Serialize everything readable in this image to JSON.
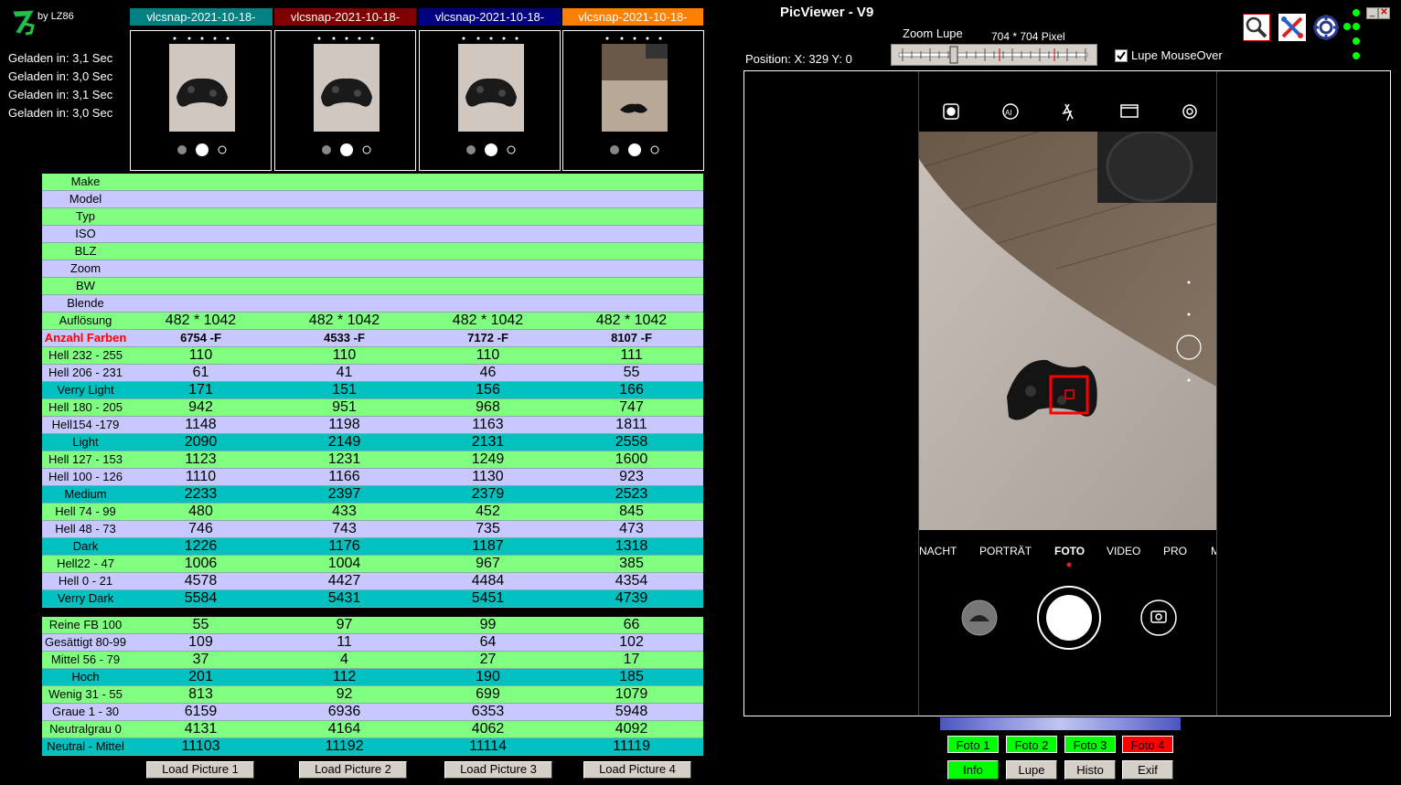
{
  "app": {
    "by": "by LZ86",
    "title": "PicViewer - V9"
  },
  "load_times": [
    "Geladen in: 3,1 Sec",
    "Geladen in: 3,0 Sec",
    "Geladen in: 3,1 Sec",
    "Geladen in: 3,0 Sec"
  ],
  "columns": [
    {
      "label": "vlcsnap-2021-10-18-",
      "color": "#008080"
    },
    {
      "label": "vlcsnap-2021-10-18-",
      "color": "#800000"
    },
    {
      "label": "vlcsnap-2021-10-18-",
      "color": "#000080"
    },
    {
      "label": "vlcsnap-2021-10-18-",
      "color": "#ff8000"
    }
  ],
  "rows": [
    {
      "label": "Make",
      "style": "g",
      "values": [
        "",
        "",
        "",
        ""
      ]
    },
    {
      "label": "Model",
      "style": "p",
      "values": [
        "",
        "",
        "",
        ""
      ]
    },
    {
      "label": "Typ",
      "style": "g",
      "values": [
        "",
        "",
        "",
        ""
      ]
    },
    {
      "label": "ISO",
      "style": "p",
      "values": [
        "",
        "",
        "",
        ""
      ]
    },
    {
      "label": "BLZ",
      "style": "g",
      "values": [
        "",
        "",
        "",
        ""
      ]
    },
    {
      "label": "Zoom",
      "style": "p",
      "values": [
        "",
        "",
        "",
        ""
      ]
    },
    {
      "label": "BW",
      "style": "g",
      "values": [
        "",
        "",
        "",
        ""
      ]
    },
    {
      "label": "Blende",
      "style": "p",
      "values": [
        "",
        "",
        "",
        ""
      ]
    },
    {
      "label": "Auflösung",
      "style": "g",
      "values": [
        "482 * 1042",
        "482 * 1042",
        "482 * 1042",
        "482 * 1042"
      ]
    },
    {
      "label": "Anzahl Farben",
      "style": "p af",
      "values": [
        "6754 -F",
        "4533 -F",
        "7172 -F",
        "8107 -F"
      ]
    },
    {
      "label": "Hell 232 - 255",
      "style": "g",
      "values": [
        "110",
        "110",
        "110",
        "111"
      ]
    },
    {
      "label": "Hell 206 - 231",
      "style": "p",
      "values": [
        "61",
        "41",
        "46",
        "55"
      ]
    },
    {
      "label": "Verry Light",
      "style": "t",
      "values": [
        "171",
        "151",
        "156",
        "166"
      ]
    },
    {
      "label": "Hell 180 - 205",
      "style": "g",
      "values": [
        "942",
        "951",
        "968",
        "747"
      ]
    },
    {
      "label": "Hell154 -179",
      "style": "p",
      "values": [
        "1148",
        "1198",
        "1163",
        "1811"
      ]
    },
    {
      "label": "Light",
      "style": "t",
      "values": [
        "2090",
        "2149",
        "2131",
        "2558"
      ]
    },
    {
      "label": "Hell 127 - 153",
      "style": "g",
      "values": [
        "1123",
        "1231",
        "1249",
        "1600"
      ]
    },
    {
      "label": "Hell 100 - 126",
      "style": "p",
      "values": [
        "1110",
        "1166",
        "1130",
        "923"
      ]
    },
    {
      "label": "Medium",
      "style": "t",
      "values": [
        "2233",
        "2397",
        "2379",
        "2523"
      ]
    },
    {
      "label": "Hell 74 - 99",
      "style": "g",
      "values": [
        "480",
        "433",
        "452",
        "845"
      ]
    },
    {
      "label": "Hell 48 - 73",
      "style": "p",
      "values": [
        "746",
        "743",
        "735",
        "473"
      ]
    },
    {
      "label": "Dark",
      "style": "t",
      "values": [
        "1226",
        "1176",
        "1187",
        "1318"
      ]
    },
    {
      "label": "Hell22 - 47",
      "style": "g",
      "values": [
        "1006",
        "1004",
        "967",
        "385"
      ]
    },
    {
      "label": "Hell 0 - 21",
      "style": "p",
      "values": [
        "4578",
        "4427",
        "4484",
        "4354"
      ]
    },
    {
      "label": "Verry Dark",
      "style": "t",
      "values": [
        "5584",
        "5431",
        "5451",
        "4739"
      ]
    },
    {
      "label": "",
      "style": "gap",
      "values": [
        "",
        "",
        "",
        ""
      ]
    },
    {
      "label": "Reine FB 100",
      "style": "g",
      "values": [
        "55",
        "97",
        "99",
        "66"
      ]
    },
    {
      "label": "Gesättigt 80-99",
      "style": "p",
      "values": [
        "109",
        "11",
        "64",
        "102"
      ]
    },
    {
      "label": "Mittel 56 - 79",
      "style": "g",
      "values": [
        "37",
        "4",
        "27",
        "17"
      ]
    },
    {
      "label": "Hoch",
      "style": "t",
      "values": [
        "201",
        "112",
        "190",
        "185"
      ]
    },
    {
      "label": "Wenig 31 - 55",
      "style": "g",
      "values": [
        "813",
        "92",
        "699",
        "1079"
      ]
    },
    {
      "label": "Graue 1 - 30",
      "style": "p",
      "values": [
        "6159",
        "6936",
        "6353",
        "5948"
      ]
    },
    {
      "label": "Neutralgrau 0",
      "style": "g",
      "values": [
        "4131",
        "4164",
        "4062",
        "4092"
      ]
    },
    {
      "label": "Neutral - Mittel",
      "style": "t",
      "values": [
        "11103",
        "11192",
        "11114",
        "11119"
      ]
    }
  ],
  "load_buttons": [
    "Load Picture 1",
    "Load Picture 2",
    "Load Picture 3",
    "Load Picture 4"
  ],
  "viewer": {
    "position": "Position: X: 329   Y: 0",
    "zoom_label": "Zoom Lupe",
    "pixel_label": "704 * 704 Pixel",
    "lupe_checkbox": "Lupe MouseOver",
    "camera_modes": [
      "NACHT",
      "PORTRÄT",
      "FOTO",
      "VIDEO",
      "PRO",
      "M"
    ]
  },
  "foto_buttons": [
    {
      "label": "Foto 1",
      "color": "#00ff00"
    },
    {
      "label": "Foto 2",
      "color": "#00ff00"
    },
    {
      "label": "Foto 3",
      "color": "#00ff00"
    },
    {
      "label": "Foto 4",
      "color": "#ff0000"
    }
  ],
  "bottom_buttons": [
    {
      "label": "Info",
      "color": "#00ff00"
    },
    {
      "label": "Lupe",
      "color": "#d4d0c8"
    },
    {
      "label": "Histo",
      "color": "#d4d0c8"
    },
    {
      "label": "Exif",
      "color": "#d4d0c8"
    }
  ],
  "icons": [
    "magnifier-icon",
    "tools-icon",
    "settings-gear-icon"
  ]
}
